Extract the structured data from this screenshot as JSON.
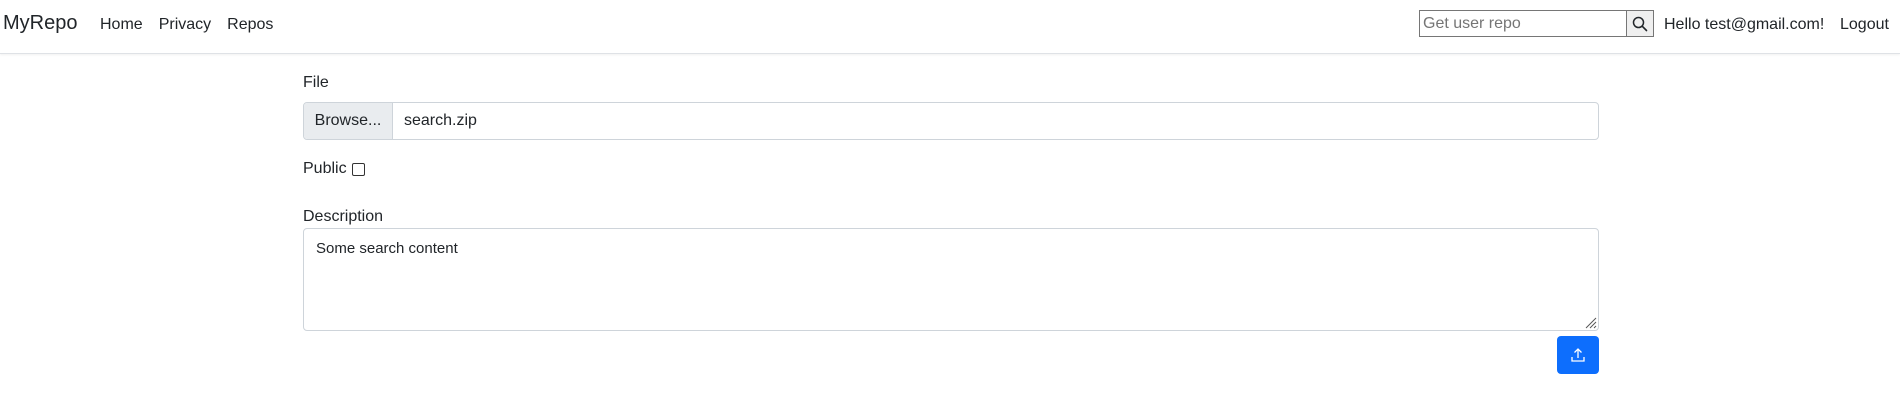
{
  "navbar": {
    "brand": "MyRepo",
    "links": [
      "Home",
      "Privacy",
      "Repos"
    ],
    "search_placeholder": "Get user repo",
    "greeting": "Hello test@gmail.com!",
    "logout": "Logout"
  },
  "form": {
    "file_label": "File",
    "browse_label": "Browse...",
    "file_name": "search.zip",
    "public_label": "Public",
    "public_checked": false,
    "description_label": "Description",
    "description_value": "Some search content"
  },
  "icons": {
    "search": "search-icon",
    "upload": "upload-icon"
  },
  "colors": {
    "primary": "#0d6efd",
    "border": "#ced4da",
    "browse_bg": "#e9ecef"
  }
}
